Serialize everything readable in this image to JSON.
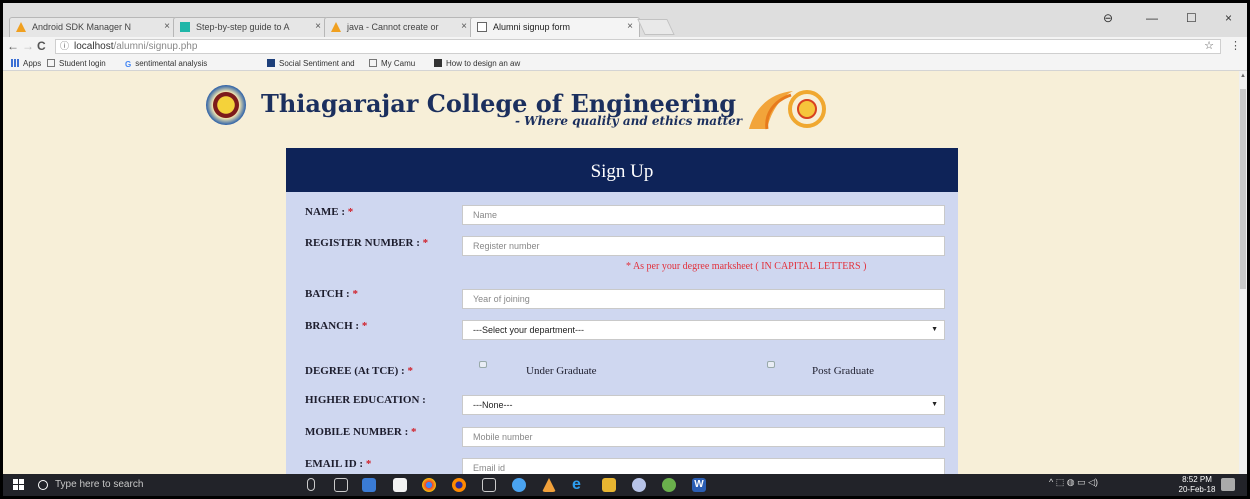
{
  "browser": {
    "tabs": [
      {
        "title": "Android SDK Manager N",
        "favicon_color": "#f0a020"
      },
      {
        "title": "Step-by-step guide to A",
        "favicon_color": "#1fb6a8"
      },
      {
        "title": "java - Cannot create or",
        "favicon_color": "#f0a020"
      },
      {
        "title": "Alumni signup form",
        "favicon_color": "#666666"
      }
    ],
    "tab_close": "×",
    "window_controls": {
      "profile": "⊖",
      "minimize": "—",
      "maximize": "☐",
      "close": "×"
    },
    "nav": {
      "back": "←",
      "forward": "→",
      "reload": "C"
    },
    "url_host": "localhost",
    "url_path": "/alumni/signup.php",
    "url_info_icon": "ⓘ",
    "bookmark_star": "☆",
    "menu": "⋮",
    "bookmarks": [
      {
        "label": "Apps",
        "icon": "apps-grid-icon"
      },
      {
        "label": "Student login",
        "icon": "page-icon"
      },
      {
        "label": "sentimental analysis",
        "icon": "google-icon"
      },
      {
        "label": "Social Sentiment and",
        "icon": "site-icon"
      },
      {
        "label": "My Camu",
        "icon": "page-icon"
      },
      {
        "label": "How to design an aw",
        "icon": "site-icon"
      }
    ]
  },
  "header": {
    "college_name": "Thiagarajar College of Engineering",
    "tagline": "- Where quality and ethics matter"
  },
  "form": {
    "title": "Sign Up",
    "required_marker": "*",
    "fields": {
      "name": {
        "label": "NAME : ",
        "placeholder": "Name"
      },
      "register_number": {
        "label": "REGISTER NUMBER : ",
        "placeholder": "Register number",
        "note": "* As per your degree marksheet ( IN CAPITAL LETTERS )"
      },
      "batch": {
        "label": "BATCH : ",
        "placeholder": "Year of joining"
      },
      "branch": {
        "label": "BRANCH : ",
        "selected": "---Select your department---"
      },
      "degree": {
        "label": "DEGREE (At TCE) : ",
        "options": [
          "Under Graduate",
          "Post Graduate"
        ]
      },
      "higher_education": {
        "label": "HIGHER EDUCATION : ",
        "selected": "---None---"
      },
      "mobile_number": {
        "label": "MOBILE NUMBER : ",
        "placeholder": "Mobile number"
      },
      "email": {
        "label": "EMAIL ID : ",
        "placeholder": "Email id"
      }
    },
    "select_caret": "▼"
  },
  "taskbar": {
    "search_placeholder": "Type here to search",
    "tray": "^ ⬚ ◍ ▭ ◁)",
    "time": "8:52 PM",
    "date": "20-Feb-18"
  },
  "colors": {
    "page_bg": "#f7efd8",
    "form_bg": "#cfd7f0",
    "form_header": "#0e2358",
    "required": "#d0202a"
  }
}
